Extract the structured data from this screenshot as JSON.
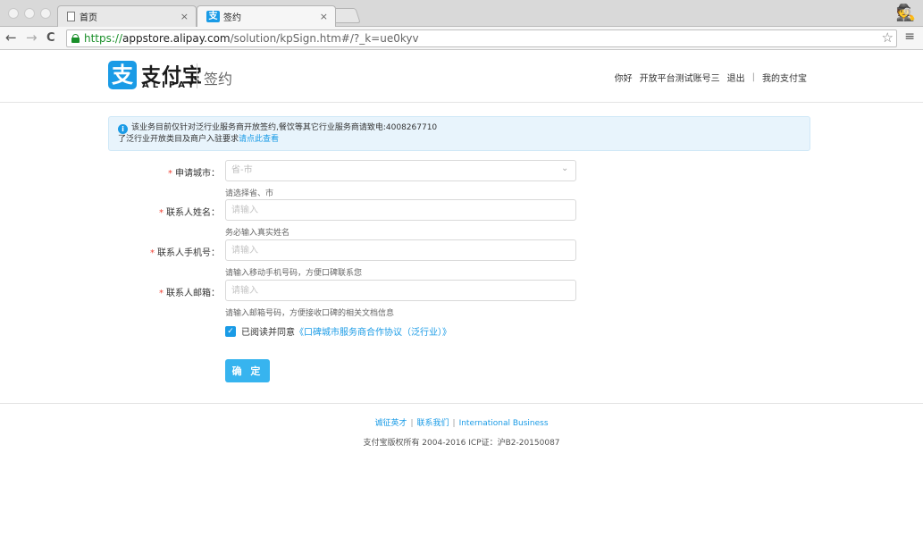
{
  "browser": {
    "tabs": [
      {
        "title": "首页",
        "close": "×"
      },
      {
        "title": "签约",
        "close": "×"
      }
    ],
    "favicon_text": "支",
    "url": {
      "scheme": "https://",
      "host": "appstore.alipay.com",
      "path": "/solution/kpSign.htm#/?_k=ue0kyv"
    },
    "icons": {
      "back": "←",
      "forward": "→",
      "reload": "C",
      "star": "☆",
      "menu": "≡",
      "incognito": "🕵"
    }
  },
  "header": {
    "logo_mark": "支",
    "logo_name": "支付宝",
    "logo_sub": "ALIPAY",
    "page_title": "签约",
    "nav": {
      "greeting": "你好",
      "account": "开放平台测试账号三",
      "logout": "退出",
      "separator": "|",
      "my_alipay": "我的支付宝"
    }
  },
  "notice": {
    "icon": "i",
    "line1": "该业务目前仅针对泛行业服务商开放签约,餐饮等其它行业服务商请致电:4008267710",
    "line2_text": "了泛行业开放类目及商户入驻要求",
    "line2_link": "请点此查看"
  },
  "form": {
    "required_mark": "*",
    "fields": [
      {
        "label": "申请城市：",
        "placeholder": "省-市",
        "hint": "请选择省、市"
      },
      {
        "label": "联系人姓名：",
        "placeholder": "请输入",
        "hint": "务必输入真实姓名"
      },
      {
        "label": "联系人手机号：",
        "placeholder": "请输入",
        "hint": "请输入移动手机号码，方便口碑联系您"
      },
      {
        "label": "联系人邮箱：",
        "placeholder": "请输入",
        "hint": "请输入邮箱号码，方便接收口碑的相关文档信息"
      }
    ],
    "select_arrow": "⌄",
    "agree_check": "✓",
    "agree_text": "已阅读并同意",
    "agree_link": "《口碑城市服务商合作协议（泛行业）》",
    "submit_label": "确 定"
  },
  "footer": {
    "links": [
      "诚征英才",
      "联系我们",
      "International Business"
    ],
    "separator": "|",
    "copyright": "支付宝版权所有 2004-2016 ICP证：沪B2-20150087"
  }
}
